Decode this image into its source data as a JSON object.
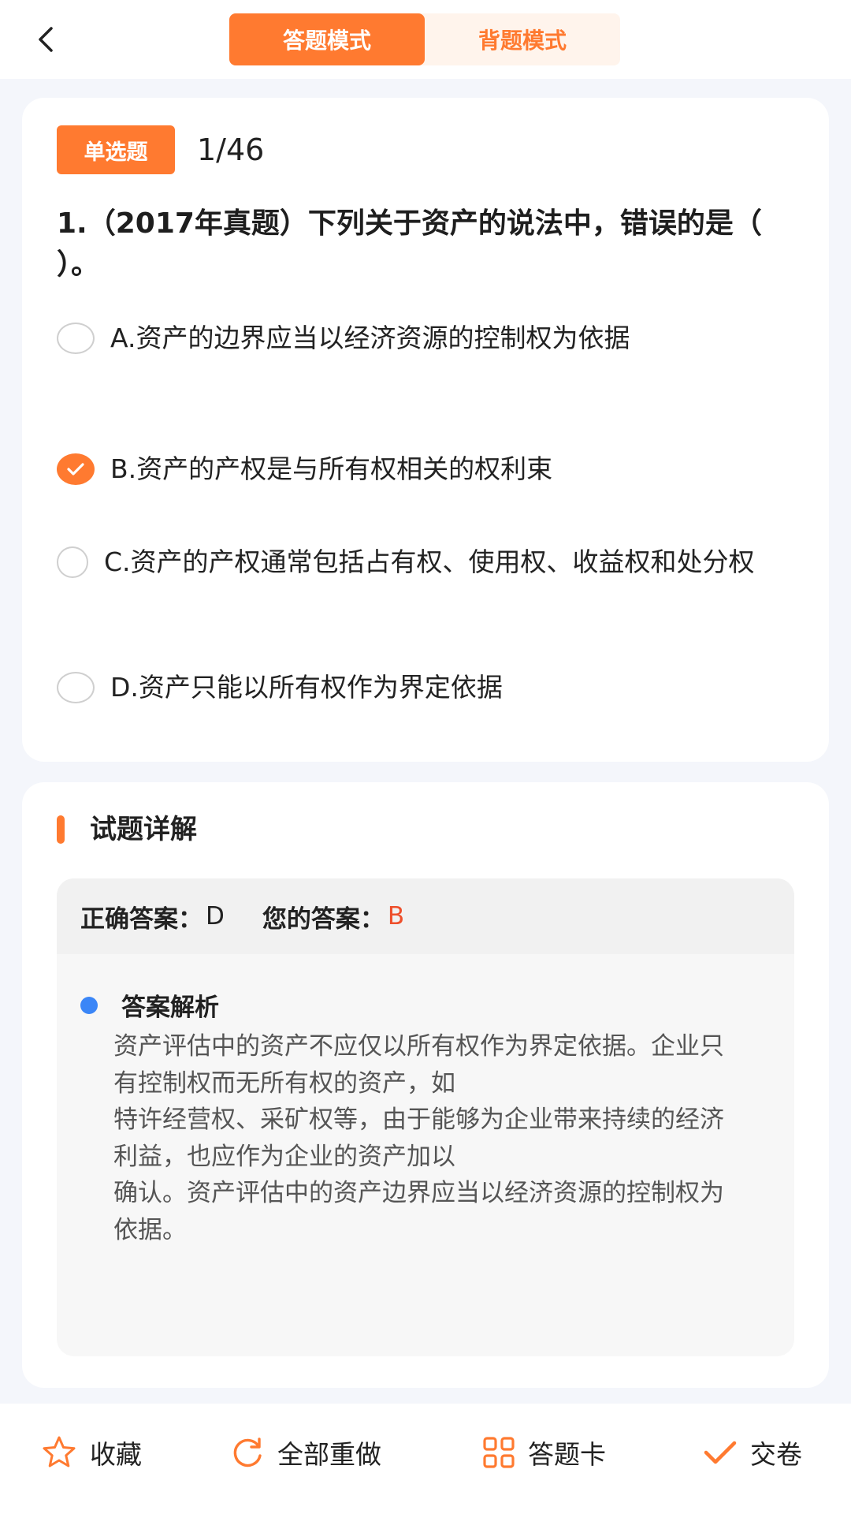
{
  "header": {
    "back_icon": "chevron-left-icon",
    "modes": [
      {
        "label": "答题模式",
        "active": true
      },
      {
        "label": "背题模式",
        "active": false
      }
    ]
  },
  "question": {
    "type_badge": "单选题",
    "progress": "1/46",
    "stem": "1.（2017年真题）下列关于资产的说法中，错误的是（ ）。",
    "options": [
      {
        "text": "A.资产的边界应当以经济资源的控制权为依据",
        "selected": false
      },
      {
        "text": "B.资产的产权是与所有权相关的权利束",
        "selected": true
      },
      {
        "text": "C.资产的产权通常包括占有权、使用权、收益权和处分权",
        "selected": false
      },
      {
        "text": "D.资产只能以所有权作为界定依据",
        "selected": false
      }
    ]
  },
  "detail": {
    "section_title": "试题详解",
    "correct_label": "正确答案：",
    "correct_value": "D",
    "your_label": "您的答案：",
    "your_value": "B",
    "analysis_title": "答案解析",
    "analysis_text": "资产评估中的资产不应仅以所有权作为界定依据。企业只有控制权而无所有权的资产，如\n特许经营权、采矿权等，由于能够为企业带来持续的经济利益，也应作为企业的资产加以\n确认。资产评估中的资产边界应当以经济资源的控制权为依据。"
  },
  "colors": {
    "accent": "#ff7a30",
    "wrong": "#ee4f2b",
    "bullet": "#3b86f7"
  },
  "bottom_bar": {
    "favorite": {
      "label": "收藏",
      "icon": "star-icon"
    },
    "redo": {
      "label": "全部重做",
      "icon": "refresh-icon"
    },
    "answer_card": {
      "label": "答题卡",
      "icon": "grid-icon"
    },
    "submit": {
      "label": "交卷",
      "icon": "check-icon"
    }
  }
}
